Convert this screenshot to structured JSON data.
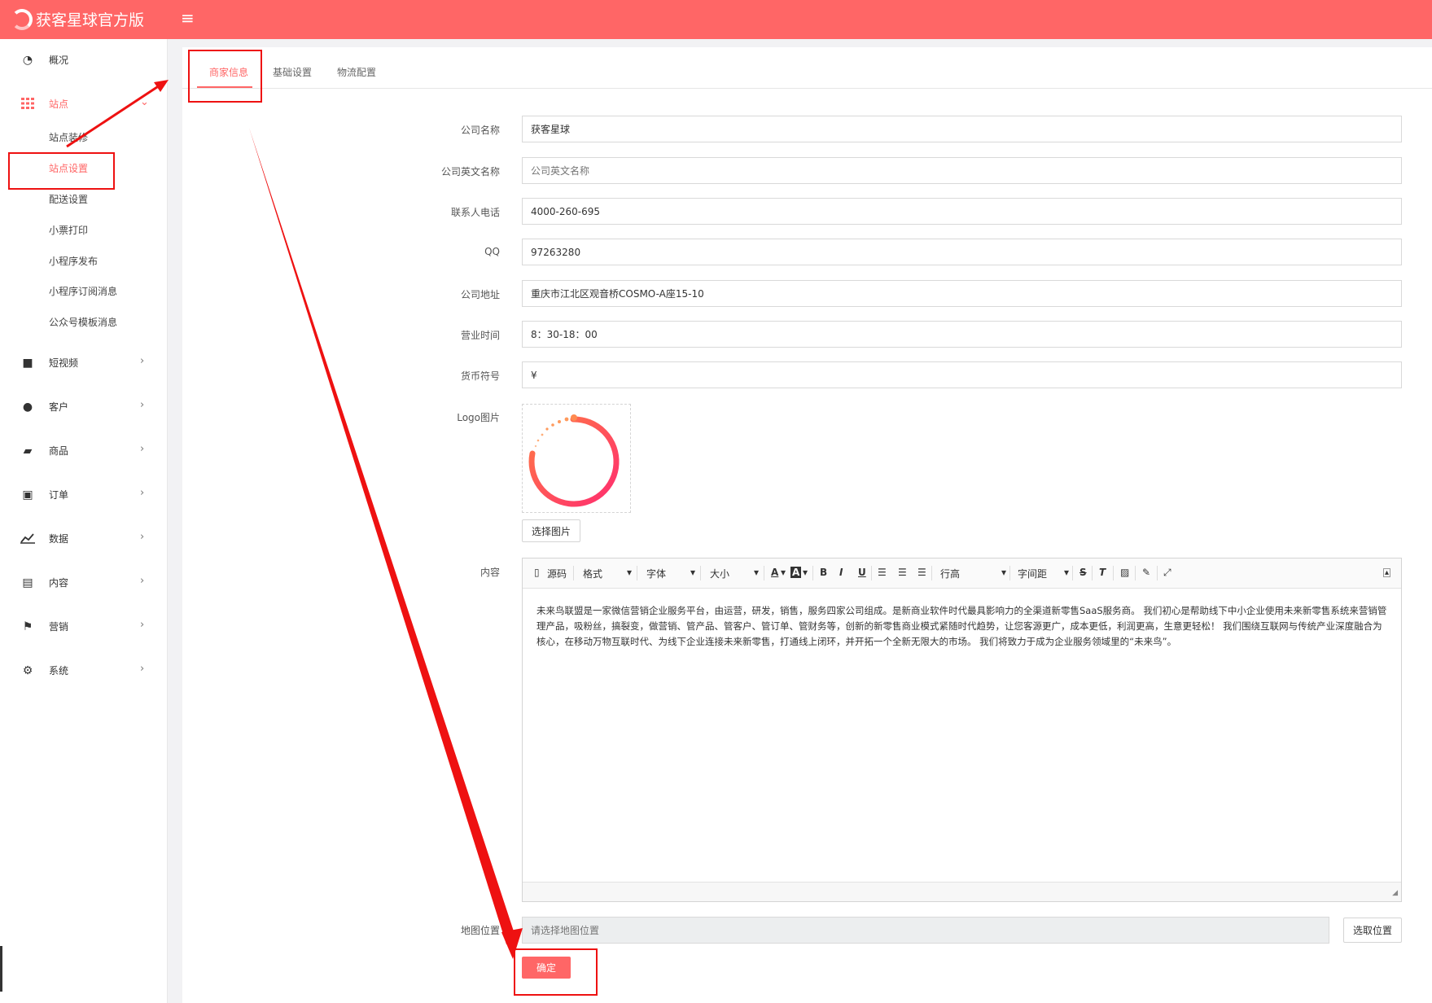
{
  "topbar": {
    "brand": "获客星球官方版",
    "menu_icon": "hamburger-icon",
    "menu_glyph": "≡"
  },
  "sidebar": {
    "items": [
      {
        "label": "概况",
        "icon": "dashboard-icon"
      },
      {
        "label": "站点",
        "icon": "grid-icon",
        "active": true,
        "expanded": true
      },
      {
        "label": "短视频",
        "icon": "video-icon"
      },
      {
        "label": "客户",
        "icon": "users-icon"
      },
      {
        "label": "商品",
        "icon": "cart-icon"
      },
      {
        "label": "订单",
        "icon": "money-icon"
      },
      {
        "label": "数据",
        "icon": "chart-icon"
      },
      {
        "label": "内容",
        "icon": "document-icon"
      },
      {
        "label": "营销",
        "icon": "flag-icon"
      },
      {
        "label": "系统",
        "icon": "gear-icon"
      }
    ],
    "sub_items": [
      {
        "label": "站点装修"
      },
      {
        "label": "站点设置",
        "active": true
      },
      {
        "label": "配送设置"
      },
      {
        "label": "小票打印"
      },
      {
        "label": "小程序发布"
      },
      {
        "label": "小程序订阅消息"
      },
      {
        "label": "公众号模板消息"
      }
    ],
    "chevron_right": "›",
    "chevron_down": "⌄"
  },
  "tabs": [
    {
      "label": "商家信息",
      "active": true
    },
    {
      "label": "基础设置"
    },
    {
      "label": "物流配置"
    }
  ],
  "form": {
    "company_name": {
      "label": "公司名称",
      "value": "获客星球"
    },
    "company_en": {
      "label": "公司英文名称",
      "value": "公司英文名称"
    },
    "phone": {
      "label": "联系人电话",
      "value": "4000-260-695"
    },
    "qq": {
      "label": "QQ",
      "value": "97263280"
    },
    "address": {
      "label": "公司地址",
      "value": "重庆市江北区观音桥COSMO-A座15-10"
    },
    "hours": {
      "label": "营业时间",
      "value": "8：30-18：00"
    },
    "currency": {
      "label": "货币符号",
      "value": "¥"
    },
    "logo": {
      "label": "Logo图片",
      "button": "选择图片"
    },
    "content": {
      "label": "内容",
      "toolbar": {
        "source": "源码",
        "format": "格式",
        "font": "字体",
        "size": "大小",
        "line_height": "行高",
        "letter_spacing": "字间距",
        "bold": "B",
        "italic": "I",
        "underline": "U",
        "strike": "S",
        "clear": "T",
        "font_color": "A",
        "bg_color": "A",
        "caret": "▾"
      },
      "body": "未来鸟联盟是一家微信营销企业服务平台，由运营，研发，销售，服务四家公司组成。是新商业软件时代最具影响力的全渠道新零售SaaS服务商。 我们初心是帮助线下中小企业使用未来新零售系统来营销管理产品，吸粉丝，搞裂变，做营销、管产品、管客户、管订单、管财务等，创新的新零售商业模式紧随时代趋势，让您客源更广，成本更低，利润更高，生意更轻松！ 我们围绕互联网与传统产业深度融合为核心，在移动万物互联时代、为线下企业连接未来新零售，打通线上闭环，并开拓一个全新无限大的市场。 我们将致力于成为企业服务领域里的“未来鸟”。"
    },
    "map": {
      "label": "地图位置",
      "placeholder": "请选择地图位置",
      "button": "选取位置"
    },
    "submit": "确定"
  },
  "colors": {
    "accent": "#ff6666",
    "annotation": "#ee1111"
  }
}
